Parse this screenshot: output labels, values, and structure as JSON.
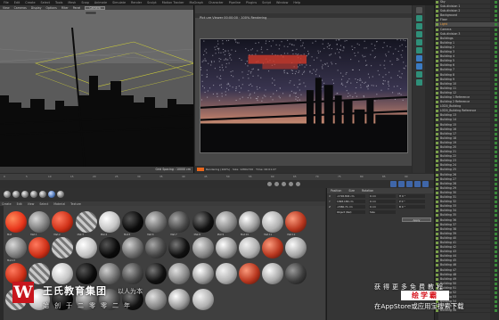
{
  "menu": [
    "File",
    "Edit",
    "Create",
    "Select",
    "Tools",
    "Mesh",
    "Snap",
    "Animate",
    "Simulate",
    "Render",
    "Sculpt",
    "Motion Tracker",
    "MoGraph",
    "Character",
    "Pipeline",
    "Plugins",
    "Script",
    "Window",
    "Help"
  ],
  "viewport": {
    "tabs": [
      "View",
      "Cameras",
      "Display",
      "Options",
      "Filter",
      "Panel"
    ],
    "camera_chip": "Camera",
    "status": "Grid Spacing : 10000 cm"
  },
  "render": {
    "title": "Pict ure Viewer 00:00:00 · 100% Rendering",
    "footer": "Rendering (100%) · Size: 1280x720 · Time: 00:01:27"
  },
  "timeline": {
    "ticks": [
      "0",
      "5",
      "10",
      "15",
      "20",
      "25",
      "30",
      "35",
      "40",
      "45",
      "50",
      "55",
      "60",
      "65",
      "70",
      "75",
      "80",
      "85",
      "90"
    ]
  },
  "materials": {
    "menu": [
      "Create",
      "Edit",
      "View",
      "Select",
      "Material",
      "Texture"
    ],
    "labels": [
      "Mat",
      "Mat.1",
      "Mat.2",
      "Mat.3",
      "Mat.4",
      "Mat.5",
      "Mat.6",
      "Mat.7",
      "Mat.8",
      "Mat.9",
      "Mat.10",
      "Mat.11",
      "Mat.12",
      "Mat.13"
    ]
  },
  "attributes": {
    "header": [
      "Position",
      "Size",
      "Rotation"
    ],
    "rows": [
      {
        "label": "X",
        "v1": "-1726.804 cm",
        "v2": "0 cm",
        "v3": "H 0 °"
      },
      {
        "label": "Y",
        "v1": "1098.186 cm",
        "v2": "0 cm",
        "v3": "P 0 °"
      },
      {
        "label": "Z",
        "v1": "-1580.71 cm",
        "v2": "0 cm",
        "v3": "B 0 °"
      }
    ],
    "mode": "Object (Rel)",
    "size_mode": "Size",
    "apply": "Apply"
  },
  "objects": [
    "Sky",
    "Sub-division 1",
    "Sub-division 2",
    "Background",
    "Floor",
    "Light",
    "Camera",
    "Sub-division 3",
    "Buildings",
    "Building 1",
    "Building 2",
    "Building 3",
    "Building 4",
    "Building 5",
    "Building 6",
    "Building 7",
    "Building 8",
    "Building 9",
    "Building 10",
    "Building 11",
    "Building 12",
    "Building 1 Reference",
    "Building 2 Reference",
    "LOD0_Building",
    "LOD0_Building Reference",
    "Building 13",
    "Building 14",
    "Building 15",
    "Building 16",
    "Building 17",
    "Building 18",
    "Building 19",
    "Building 20",
    "Building 21",
    "Building 22",
    "Building 23",
    "Building 24",
    "Building 25",
    "Building 26",
    "Building 27",
    "Building 28",
    "Building 29",
    "Building 30",
    "Building 31",
    "Building 32",
    "Building 33",
    "Building 34",
    "Building 35",
    "Building 36",
    "Building 37",
    "Building 38",
    "Building 39",
    "Building 40",
    "Building 41",
    "Building 42",
    "Building 43",
    "Building 44",
    "Building 45",
    "Building 46",
    "Building 47",
    "Building 48",
    "Building 49",
    "Building 50",
    "Building 51",
    "Building 52",
    "Building 53",
    "Building 54",
    "Building 55",
    "Building 56"
  ],
  "selected_object_index": 5,
  "watermark": {
    "logo_glyph": "W",
    "brand": "王氏教育集团",
    "sub": "以人为本",
    "slogan": "始创于二零零二年",
    "right_line1": "获得更多免费教程",
    "badge": "绘学霸",
    "right_line2": "在AppStore或应用宝搜索下载"
  },
  "colors": {
    "accent_orange": "#e8661c",
    "brand_red": "#c8161d",
    "object_tag": "#7aa04a"
  }
}
